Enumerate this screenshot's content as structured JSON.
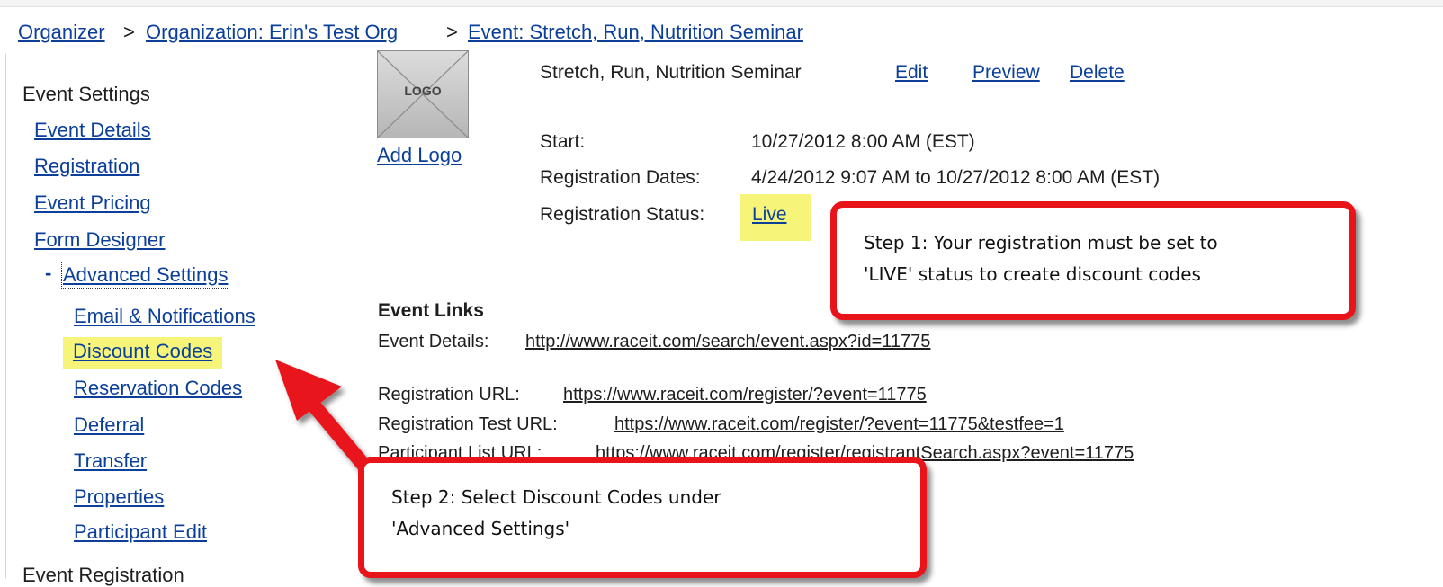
{
  "breadcrumb": {
    "organizer": "Organizer",
    "sep1": ">",
    "organization": "Organization: Erin's Test Org",
    "sep2": ">",
    "event": "Event: Stretch, Run, Nutrition Seminar"
  },
  "sidebar": {
    "heading": "Event Settings",
    "items": [
      "Event Details",
      "Registration",
      "Event Pricing",
      "Form Designer"
    ],
    "advanced_toggle": "-",
    "advanced_label": "Advanced Settings",
    "sub_items": [
      "Email & Notifications",
      "Discount Codes",
      "Reservation Codes",
      "Deferral",
      "Transfer",
      "Properties",
      "Participant Edit"
    ],
    "next_heading": "Event Registration"
  },
  "logo": {
    "placeholder_text": "LOGO",
    "add_link": "Add Logo"
  },
  "event": {
    "title": "Stretch, Run, Nutrition Seminar",
    "actions": {
      "edit": "Edit",
      "preview": "Preview",
      "delete": "Delete"
    },
    "start_label": "Start:",
    "start_value": "10/27/2012 8:00 AM (EST)",
    "reg_dates_label": "Registration Dates:",
    "reg_dates_value": "4/24/2012 9:07 AM to 10/27/2012 8:00 AM (EST)",
    "status_label": "Registration Status:",
    "status_value": "Live"
  },
  "links": {
    "heading": "Event Links",
    "event_details_label": "Event Details:",
    "event_details_url": "http://www.raceit.com/search/event.aspx?id=11775",
    "registration_label": "Registration URL:",
    "registration_url": "https://www.raceit.com/register/?event=11775",
    "registration_test_label": "Registration Test URL:",
    "registration_test_url": "https://www.raceit.com/register/?event=11775&testfee=1",
    "participant_list_label": "Participant List URL:",
    "participant_list_url": "https://www.raceit.com/register/registrantSearch.aspx?event=11775"
  },
  "callouts": {
    "step1_line1": "Step 1: Your registration must be set to",
    "step1_line2": "'LIVE' status to create discount codes",
    "step2_line1": "Step 2: Select Discount Codes under",
    "step2_line2": "'Advanced Settings'"
  },
  "colors": {
    "link": "#0b3f99",
    "highlight": "#f6f57a",
    "callout_border": "#e8141a"
  }
}
